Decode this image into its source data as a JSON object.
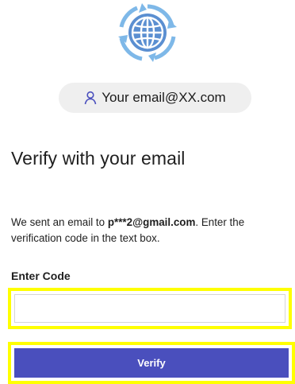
{
  "account": {
    "email_label": "Your email@XX.com",
    "icon": "person-icon"
  },
  "logo": {
    "icon": "globe-arrows-icon"
  },
  "main": {
    "title": "Verify with your email",
    "description_prefix": "We sent an email to ",
    "masked_email": "p***2@gmail.com",
    "description_suffix": ". Enter the verification code in the text box.",
    "code_label": "Enter Code",
    "code_value": "",
    "verify_label": "Verify"
  },
  "colors": {
    "primary": "#4a4fbd",
    "highlight": "#ffff00",
    "logo_blue": "#5b8fd1"
  }
}
